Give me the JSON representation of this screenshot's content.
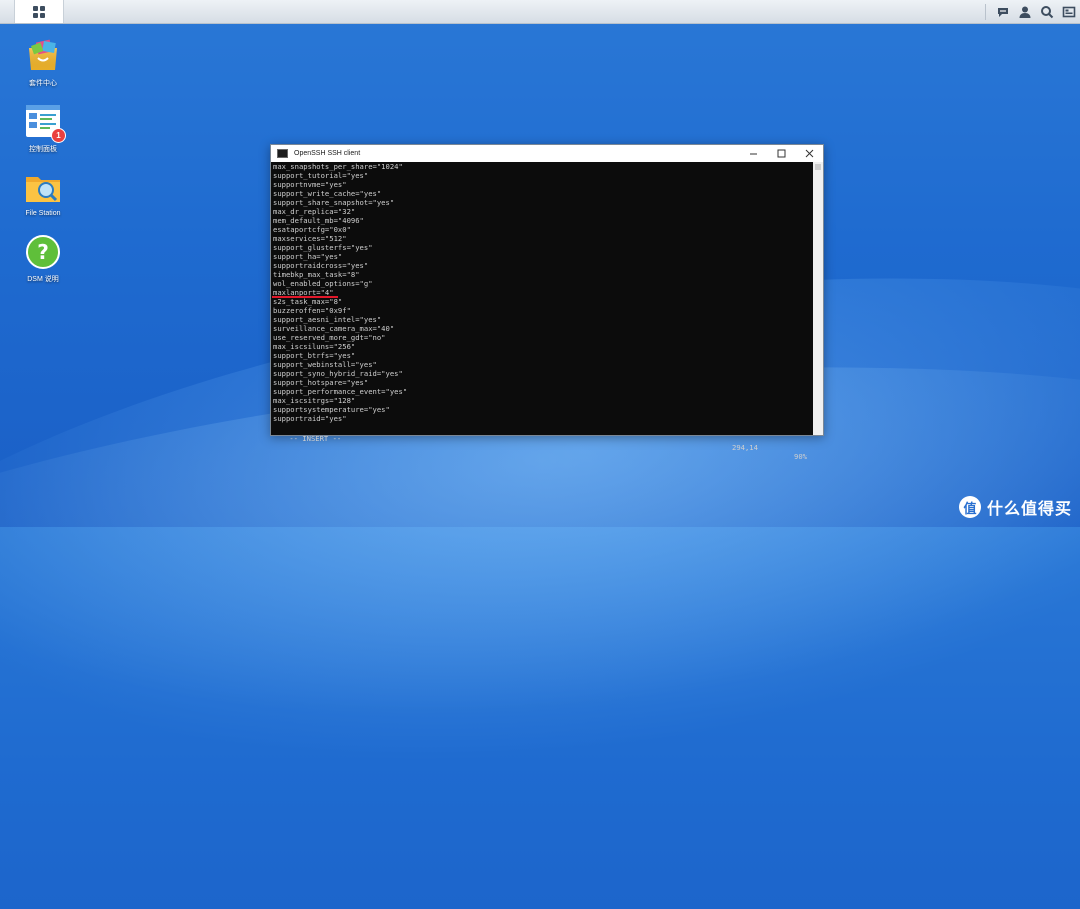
{
  "taskbar": {
    "icons": [
      "chat-icon",
      "user-icon",
      "search-icon",
      "widgets-icon"
    ]
  },
  "desktop": {
    "icons": [
      {
        "label": "套件中心"
      },
      {
        "label": "控制面板",
        "badge": "1"
      },
      {
        "label": "File Station"
      },
      {
        "label": "DSM 说明"
      }
    ]
  },
  "terminal": {
    "title": "OpenSSH SSH client",
    "lines": [
      "max_snapshots_per_share=\"1024\"",
      "support_tutorial=\"yes\"",
      "supportnvme=\"yes\"",
      "support_write_cache=\"yes\"",
      "support_share_snapshot=\"yes\"",
      "max_dr_replica=\"32\"",
      "mem_default_mb=\"4096\"",
      "esataportcfg=\"0x0\"",
      "maxservices=\"512\"",
      "support_glusterfs=\"yes\"",
      "support_ha=\"yes\"",
      "supportraidcross=\"yes\"",
      "timebkp_max_task=\"8\"",
      "wol_enabled_options=\"g\"",
      "maxlanport=\"4\"",
      "s2s_task_max=\"8\"",
      "buzzeroffen=\"0x9f\"",
      "support_aesni_intel=\"yes\"",
      "surveillance_camera_max=\"40\"",
      "use_reserved_more_gdt=\"no\"",
      "max_iscsiluns=\"256\"",
      "support_btrfs=\"yes\"",
      "support_webinstall=\"yes\"",
      "support_syno_hybrid_raid=\"yes\"",
      "support_hotspare=\"yes\"",
      "support_performance_event=\"yes\"",
      "max_iscsitrgs=\"128\"",
      "supportsystemperature=\"yes\"",
      "supportraid=\"yes\""
    ],
    "mode": "-- INSERT --",
    "cursor_pos": "294,14",
    "percent": "90%"
  },
  "watermark": {
    "logo": "值",
    "text": "什么值得买"
  }
}
